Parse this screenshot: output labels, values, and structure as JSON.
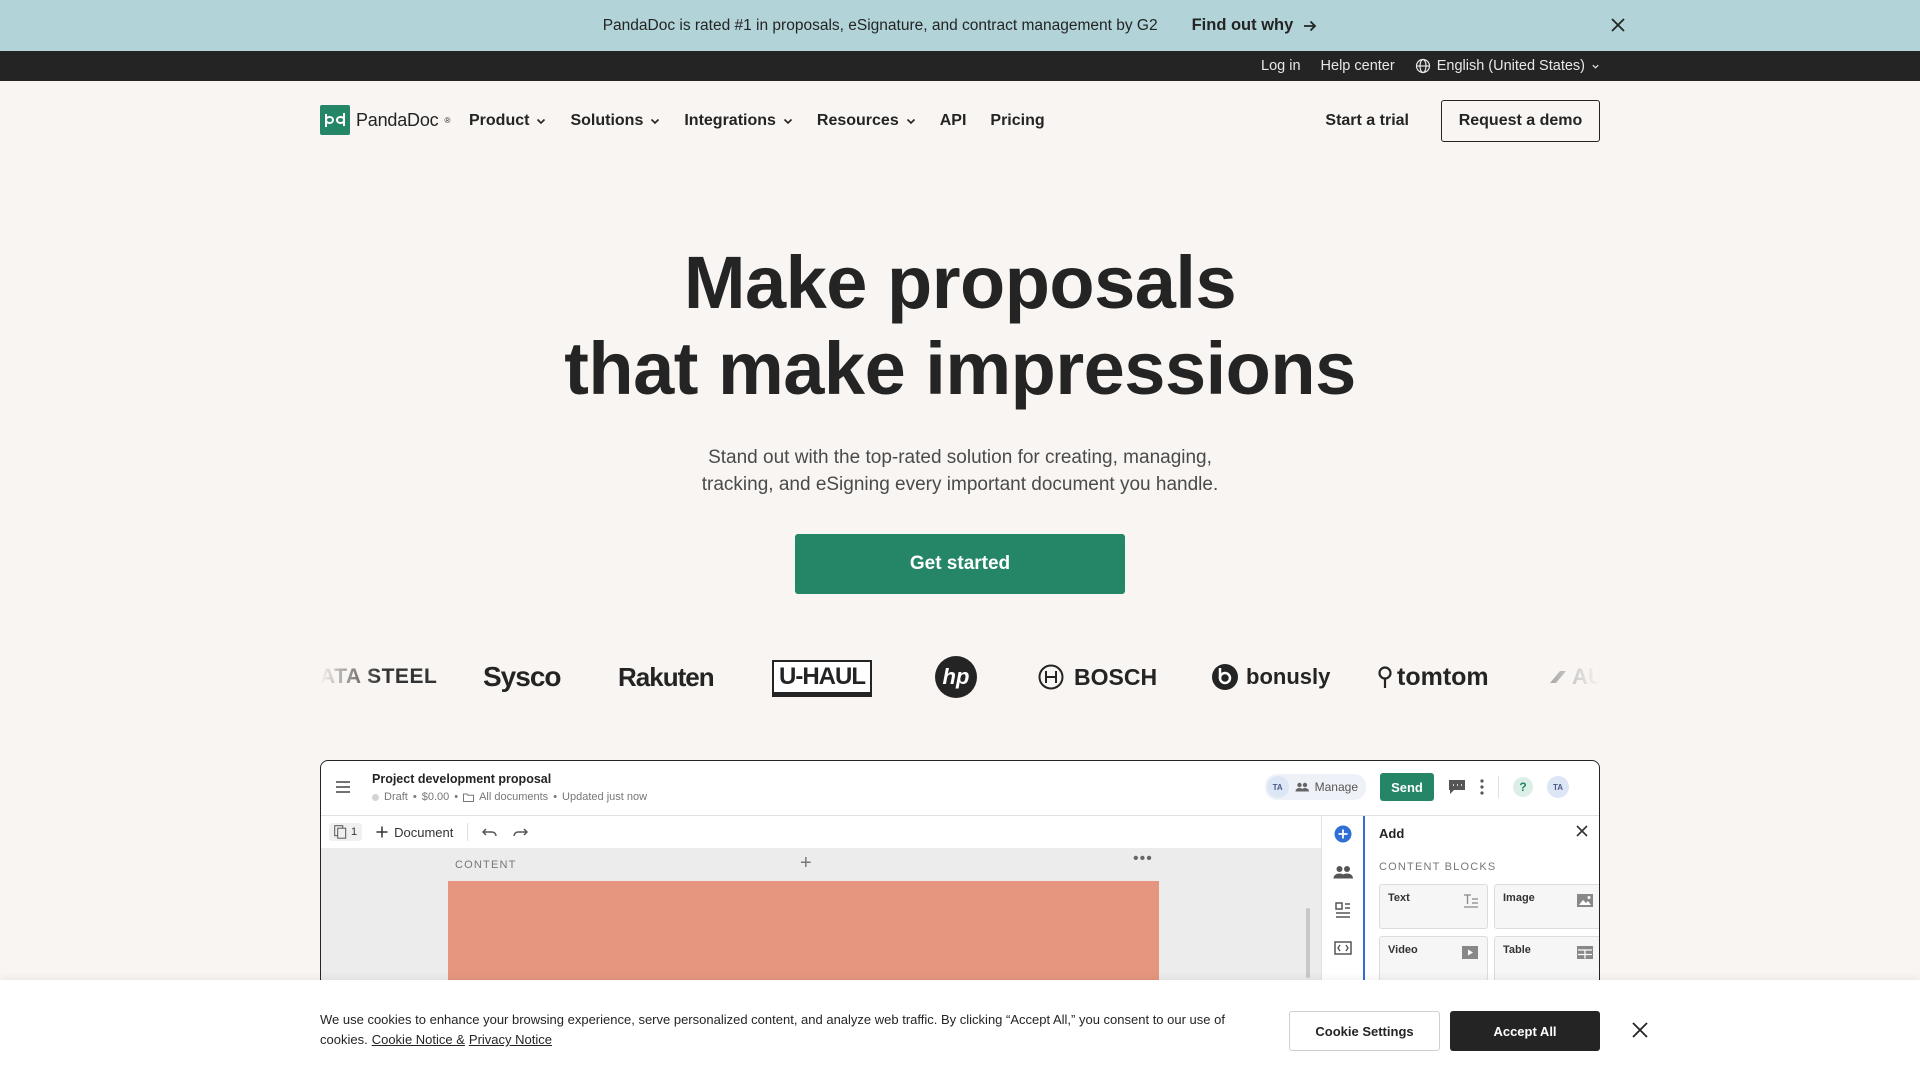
{
  "announcement": {
    "text": "PandaDoc is rated #1 in proposals, eSignature, and contract management by G2",
    "link_label": "Find out why"
  },
  "utility": {
    "login": "Log in",
    "help": "Help center",
    "language": "English (United States)"
  },
  "header": {
    "brand": "PandaDoc",
    "nav": [
      "Product",
      "Solutions",
      "Integrations",
      "Resources",
      "API",
      "Pricing"
    ],
    "trial": "Start a trial",
    "demo": "Request a demo"
  },
  "hero": {
    "title_line1": "Make proposals",
    "title_line2": "that make impressions",
    "subtitle_line1": "Stand out with the top-rated solution for creating, managing,",
    "subtitle_line2": "tracking, and eSigning every important document you handle.",
    "cta": "Get started"
  },
  "logos": [
    "ATA STEEL",
    "Sysco",
    "Rakuten",
    "U-HAUL",
    "hp",
    "BOSCH",
    "bonusly",
    "tomtom",
    "AU"
  ],
  "preview": {
    "doc_title": "Project development proposal",
    "status": "Draft",
    "amount": "$0.00",
    "folder": "All documents",
    "updated": "Updated just now",
    "avatar_initials": "TA",
    "manage": "Manage",
    "send": "Send",
    "help": "?",
    "page_count": "1",
    "add_document": "Document",
    "content_label": "CONTENT",
    "panel": {
      "title": "Add",
      "section": "CONTENT BLOCKS",
      "blocks": [
        "Text",
        "Image",
        "Video",
        "Table"
      ]
    },
    "colors": {
      "brand_green": "#248567",
      "content_block": "#e6967e",
      "panel_accent": "#2f6fd6"
    }
  },
  "cookie": {
    "text_line1": "We use cookies to enhance your browsing experience, serve personalized content, and analyze web traffic. By clicking “Accept All,” you consent to our use of",
    "text_line2": "cookies.",
    "notice_link": "Cookie Notice &",
    "privacy_link": "Privacy Notice",
    "settings": "Cookie Settings",
    "accept": "Accept All"
  }
}
